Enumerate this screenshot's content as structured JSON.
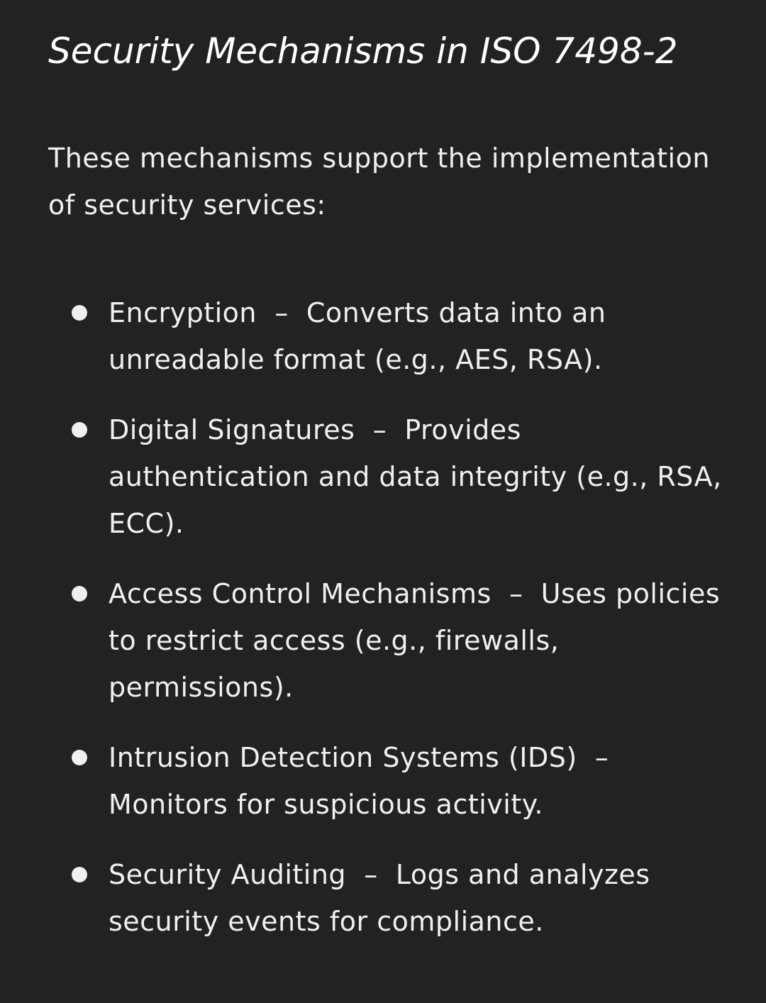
{
  "title": "Security Mechanisms in ISO 7498-2",
  "intro": "These mechanisms support the implementation of security services:",
  "items": [
    {
      "term": "Encryption",
      "separator": "–",
      "description": "Converts data into an unreadable format (e.g., AES, RSA)."
    },
    {
      "term": "Digital Signatures",
      "separator": "–",
      "description": "Provides authentication and data integrity (e.g., RSA, ECC)."
    },
    {
      "term": "Access Control Mechanisms",
      "separator": "–",
      "description": "Uses policies to restrict access (e.g., firewalls, permissions)."
    },
    {
      "term": "Intrusion Detection Systems (IDS)",
      "separator": "–",
      "description": "Monitors for suspicious activity."
    },
    {
      "term": "Security Auditing",
      "separator": "–",
      "description": "Logs and analyzes security events for compliance."
    }
  ]
}
